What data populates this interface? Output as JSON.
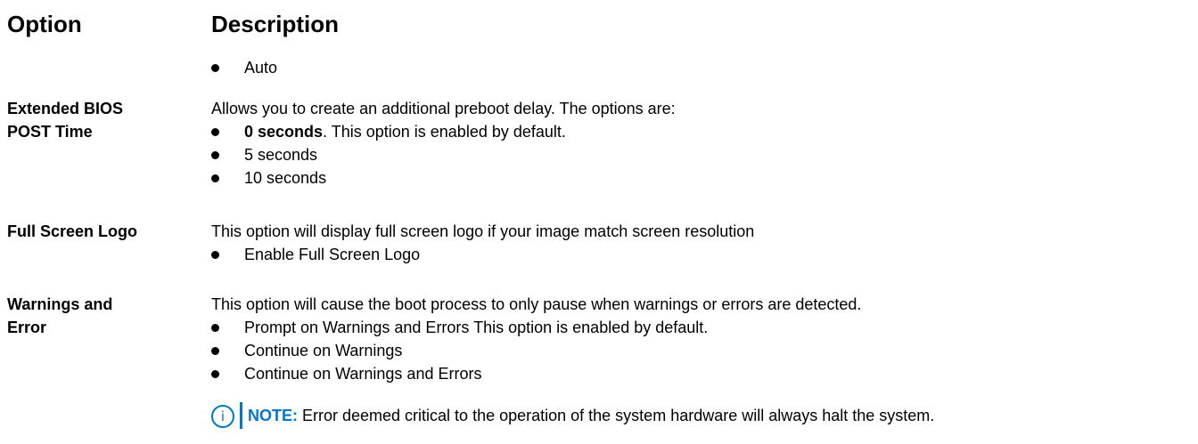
{
  "header": {
    "option": "Option",
    "description": "Description"
  },
  "rows": [
    {
      "option": "",
      "intro": "",
      "bullets": [
        {
          "bold": "",
          "text": "Auto"
        }
      ]
    },
    {
      "option_line1": "Extended BIOS",
      "option_line2": "POST Time",
      "intro": "Allows you to create an additional preboot delay. The options are:",
      "bullets": [
        {
          "bold": "0 seconds",
          "text": ". This option is enabled by default."
        },
        {
          "bold": "",
          "text": "5 seconds"
        },
        {
          "bold": "",
          "text": "10 seconds"
        }
      ]
    },
    {
      "option_line1": "Full Screen Logo",
      "intro": "This option will display full screen logo if your image match screen resolution",
      "bullets": [
        {
          "bold": "",
          "text": "Enable Full Screen Logo"
        }
      ]
    },
    {
      "option_line1": "Warnings and",
      "option_line2": "Error",
      "intro": "This option will cause the boot process to only pause when warnings or errors are detected.",
      "bullets": [
        {
          "bold": "",
          "text": "Prompt on Warnings and Errors This option is enabled by default."
        },
        {
          "bold": "",
          "text": "Continue on Warnings"
        },
        {
          "bold": "",
          "text": "Continue on Warnings and Errors"
        }
      ]
    }
  ],
  "note": {
    "icon": "info-icon",
    "icon_glyph": "i",
    "label": "NOTE:",
    "text": " Error deemed critical to the operation of the system hardware will always halt the system."
  },
  "colors": {
    "accent": "#0076ce",
    "text": "#000000",
    "background": "#ffffff"
  }
}
